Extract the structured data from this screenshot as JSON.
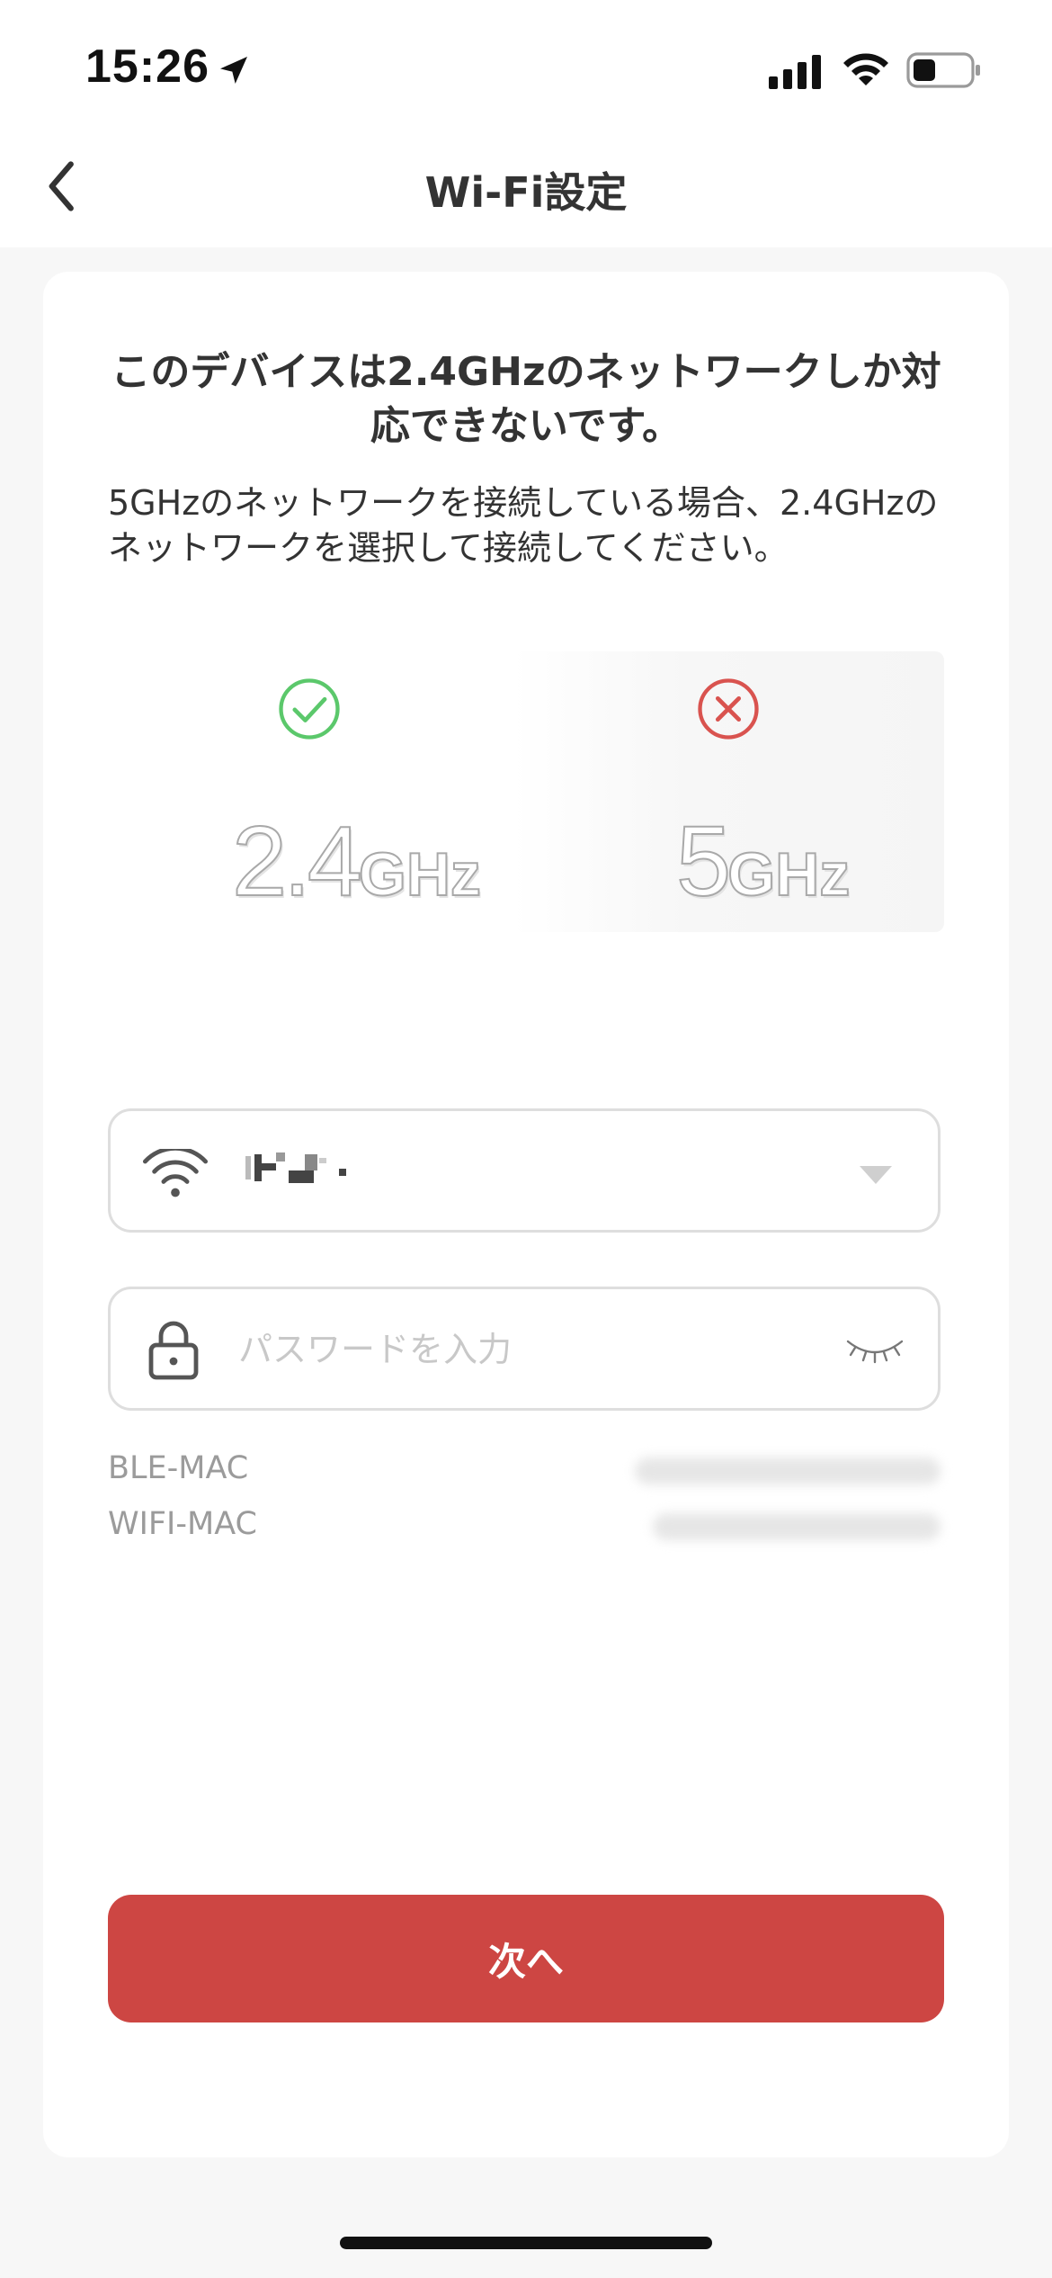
{
  "status_bar": {
    "time": "15:26",
    "icons": [
      "location-arrow-icon",
      "cellular-signal-icon",
      "wifi-icon",
      "battery-icon"
    ]
  },
  "nav": {
    "title": "Wi-Fi設定",
    "back_icon": "chevron-left-icon"
  },
  "card": {
    "heading": "このデバイスは2.4GHzのネットワークしか対応できないです。",
    "description": "5GHzのネットワークを接続している場合、2.4GHzのネットワークを選択して接続してください。"
  },
  "frequencies": {
    "supported": {
      "number": "2.4",
      "unit": "GHz",
      "status_icon": "check-circle-icon",
      "status_color": "#5bc86b"
    },
    "unsupported": {
      "number": "5",
      "unit": "GHz",
      "status_icon": "cross-circle-icon",
      "status_color": "#d9534f"
    }
  },
  "form": {
    "ssid": {
      "icon": "wifi-icon",
      "value_redacted": true,
      "dropdown_icon": "triangle-down-icon"
    },
    "password": {
      "icon": "lock-icon",
      "placeholder": "パスワードを入力",
      "value": "",
      "toggle_icon": "eye-closed-icon"
    }
  },
  "mac": {
    "ble_label": "BLE-MAC",
    "wifi_label": "WIFI-MAC"
  },
  "actions": {
    "next_label": "次へ"
  },
  "colors": {
    "accent": "#cd4643",
    "background": "#f7f7f7",
    "card": "#ffffff",
    "check": "#5bc86b",
    "cross": "#d9534f"
  }
}
